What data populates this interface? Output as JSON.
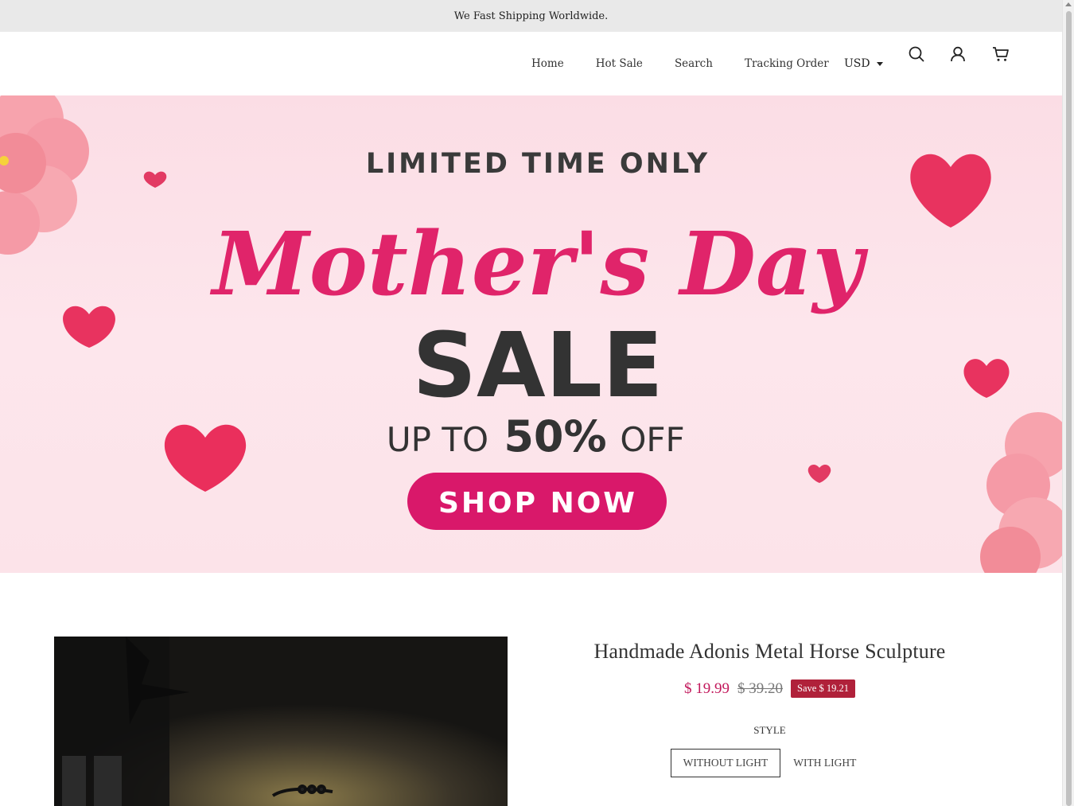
{
  "announcement": "We Fast Shipping Worldwide.",
  "nav": {
    "items": [
      "Home",
      "Hot Sale",
      "Search",
      "Tracking Order"
    ],
    "currency": "USD",
    "icons": [
      "search-icon",
      "account-icon",
      "cart-icon"
    ]
  },
  "banner": {
    "line1": "LIMITED TIME ONLY",
    "script": "Mother's Day",
    "sale": "SALE",
    "up_to": "UP TO",
    "percent": "50%",
    "off": "OFF",
    "cta": "SHOP NOW",
    "accent": "#e0246a"
  },
  "product": {
    "title": "Handmade Adonis Metal Horse Sculpture",
    "price": "$ 19.99",
    "compare_price": "$ 39.20",
    "save": "Save $ 19.21",
    "style_label": "STYLE",
    "options": [
      "WITHOUT LIGHT",
      "WITH LIGHT"
    ],
    "selected_option": "WITHOUT LIGHT"
  },
  "colors": {
    "price": "#c2185b",
    "save_badge": "#b0213a",
    "announcement_bg": "#e9e9e9"
  }
}
